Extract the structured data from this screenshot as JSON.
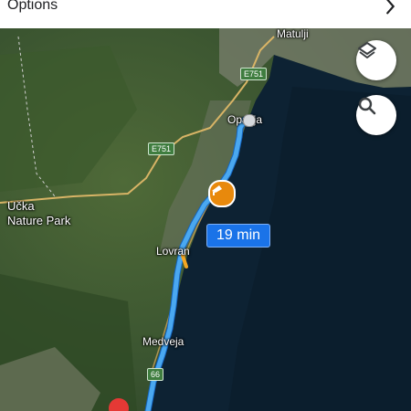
{
  "topbar": {
    "title": "Options",
    "chevron_icon": "chevron-right-icon"
  },
  "map": {
    "places": {
      "matulji": "Matulji",
      "opatija": "Opatija",
      "lovran": "Lovran",
      "medveja": "Medveja",
      "ucka": "Učka\nNature Park"
    },
    "roads": {
      "e751_top": "E751",
      "e751_mid": "E751",
      "r66": "66"
    },
    "eta": "19 min",
    "buttons": {
      "layers_icon": "layers-icon",
      "search_icon": "search-icon"
    },
    "markers": {
      "start": "start-dot",
      "incident": "incident-icon",
      "destination": "destination-pin"
    }
  },
  "colors": {
    "route": "#4aa8f0",
    "eta_bg": "#1a73e8",
    "incident": "#e8890c",
    "pin": "#e53935",
    "sea": "#0d2233"
  }
}
